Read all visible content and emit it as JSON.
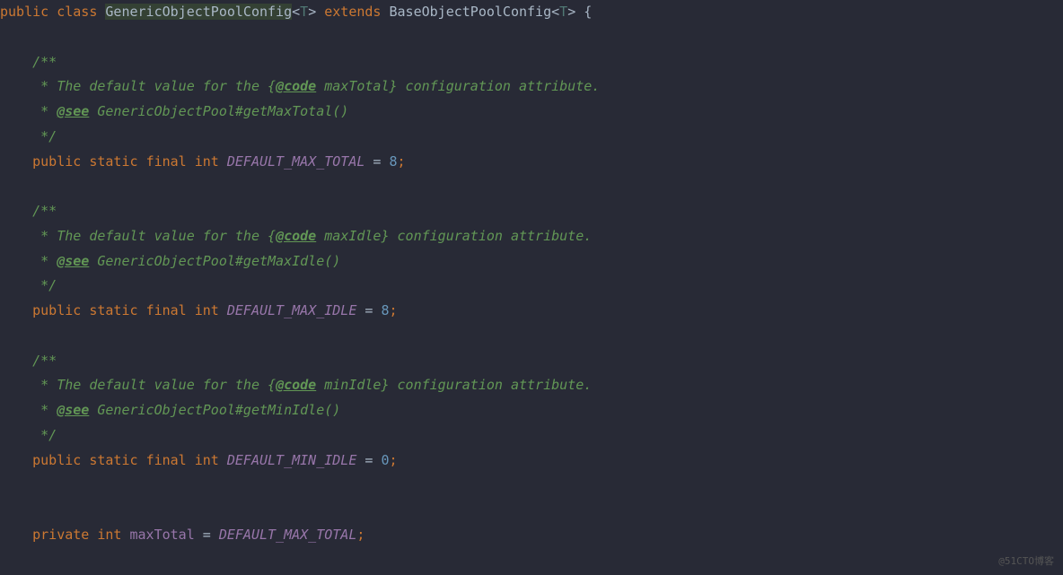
{
  "code": {
    "line1": {
      "kw_public": "public",
      "kw_class": "class",
      "class_name": "GenericObjectPoolConfig",
      "generic_open": "<",
      "generic_t": "T",
      "generic_close": ">",
      "kw_extends": "extends",
      "parent_class": "BaseObjectPoolConfig",
      "brace_open": "{"
    },
    "javadoc1": {
      "open": "/**",
      "desc_prefix": " * The default value for the {",
      "tag_code": "@code",
      "desc_suffix": " maxTotal} configuration attribute.",
      "see_prefix": " * ",
      "tag_see": "@see",
      "see_ref": " GenericObjectPool#getMaxTotal()",
      "close": " */"
    },
    "field1": {
      "kw_public": "public",
      "kw_static": "static",
      "kw_final": "final",
      "kw_int": "int",
      "name": "DEFAULT_MAX_TOTAL",
      "eq": " = ",
      "value": "8",
      "semi": ";"
    },
    "javadoc2": {
      "open": "/**",
      "desc_prefix": " * The default value for the {",
      "tag_code": "@code",
      "desc_suffix": " maxIdle} configuration attribute.",
      "see_prefix": " * ",
      "tag_see": "@see",
      "see_ref": " GenericObjectPool#getMaxIdle()",
      "close": " */"
    },
    "field2": {
      "kw_public": "public",
      "kw_static": "static",
      "kw_final": "final",
      "kw_int": "int",
      "name": "DEFAULT_MAX_IDLE",
      "eq": " = ",
      "value": "8",
      "semi": ";"
    },
    "javadoc3": {
      "open": "/**",
      "desc_prefix": " * The default value for the {",
      "tag_code": "@code",
      "desc_suffix": " minIdle} configuration attribute.",
      "see_prefix": " * ",
      "tag_see": "@see",
      "see_ref": " GenericObjectPool#getMinIdle()",
      "close": " */"
    },
    "field3": {
      "kw_public": "public",
      "kw_static": "static",
      "kw_final": "final",
      "kw_int": "int",
      "name": "DEFAULT_MIN_IDLE",
      "eq": " = ",
      "value": "0",
      "semi": ";"
    },
    "field4": {
      "kw_private": "private",
      "kw_int": "int",
      "name": "maxTotal",
      "eq": " = ",
      "value": "DEFAULT_MAX_TOTAL",
      "semi": ";"
    }
  },
  "watermark": "@51CTO博客"
}
